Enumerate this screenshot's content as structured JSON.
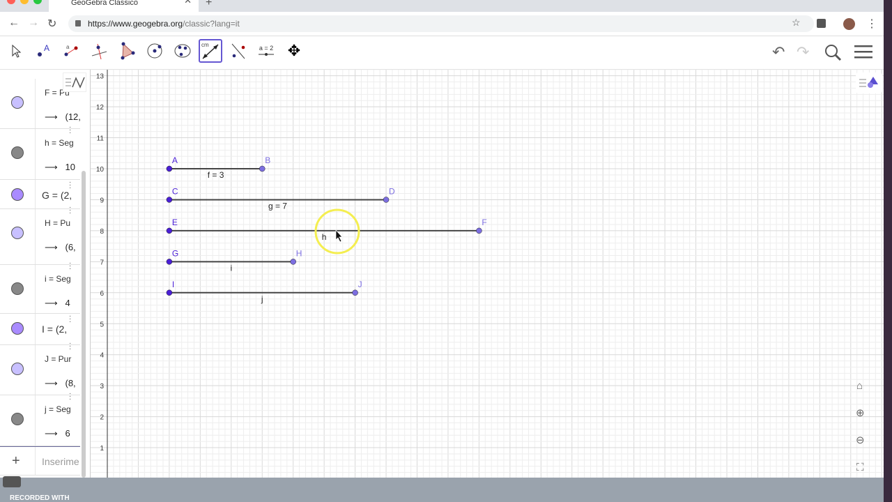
{
  "browser": {
    "tab_title": "GeoGebra Classico",
    "url_host": "https://www.geogebra.org",
    "url_path": "/classic?lang=it"
  },
  "toolbar": {
    "tools": [
      "move",
      "point",
      "segment",
      "perpendicular-line",
      "polygon",
      "circle-center-point",
      "conic-5-points",
      "distance",
      "reflect",
      "slider",
      "move-graphics"
    ],
    "distance_label": "cm",
    "slider_label": "a = 2"
  },
  "algebra": {
    "rows": [
      {
        "def": "F = Pu",
        "val": "(12,",
        "color": "#c8c0ff"
      },
      {
        "def": "h = Seg",
        "val": "10",
        "color": "#888888"
      },
      {
        "def": "G = (2,",
        "val": "",
        "color": "#a98bff"
      },
      {
        "def": "H = Pu",
        "val": "(6,",
        "color": "#c8c0ff"
      },
      {
        "def": "i = Seg",
        "val": "4",
        "color": "#888888"
      },
      {
        "def": "I = (2,",
        "val": "",
        "color": "#a98bff"
      },
      {
        "def": "J = Pur",
        "val": "(8,",
        "color": "#c8c0ff"
      },
      {
        "def": "j = Seg",
        "val": "6",
        "color": "#888888"
      }
    ],
    "arrow": "⟶",
    "input_placeholder": "Inserime"
  },
  "graphics": {
    "x_range": [
      0,
      24
    ],
    "y_range": [
      0,
      13
    ],
    "points": [
      {
        "name": "A",
        "x": 2,
        "y": 10,
        "free": true
      },
      {
        "name": "B",
        "x": 5,
        "y": 10,
        "free": false
      },
      {
        "name": "C",
        "x": 2,
        "y": 9,
        "free": true
      },
      {
        "name": "D",
        "x": 9,
        "y": 9,
        "free": false
      },
      {
        "name": "E",
        "x": 2,
        "y": 8,
        "free": true
      },
      {
        "name": "F",
        "x": 12,
        "y": 8,
        "free": false
      },
      {
        "name": "G",
        "x": 2,
        "y": 7,
        "free": true
      },
      {
        "name": "H",
        "x": 6,
        "y": 7,
        "free": false
      },
      {
        "name": "I",
        "x": 2,
        "y": 6,
        "free": true
      },
      {
        "name": "J",
        "x": 8,
        "y": 6,
        "free": false
      }
    ],
    "segments": [
      {
        "from": "A",
        "to": "B",
        "label": "f = 3"
      },
      {
        "from": "C",
        "to": "D",
        "label": "g = 7"
      },
      {
        "from": "E",
        "to": "F",
        "label": "h"
      },
      {
        "from": "G",
        "to": "H",
        "label": "i"
      },
      {
        "from": "I",
        "to": "J",
        "label": "j"
      }
    ],
    "free_color": "#4a1fd6",
    "dep_color": "#7c6ee0"
  },
  "dock": {
    "recorded": "RECORDED WITH"
  }
}
